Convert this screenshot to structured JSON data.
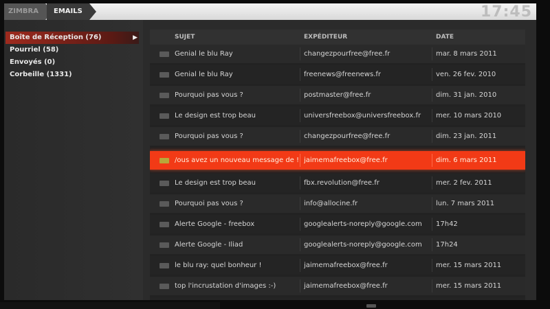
{
  "header": {
    "breadcrumb_app": "ZIMBRA",
    "breadcrumb_section": "EMAILS",
    "clock": "17:45"
  },
  "sidebar": {
    "folders": [
      {
        "label": "Boîte de Réception (76)"
      },
      {
        "label": "Pourriel (58)"
      },
      {
        "label": "Envoyés (0)"
      },
      {
        "label": "Corbeille (1331)"
      }
    ]
  },
  "list": {
    "columns": {
      "subject": "SUJET",
      "sender": "EXPÉDITEUR",
      "date": "DATE"
    },
    "rows": [
      {
        "subject": "Genial le blu Ray",
        "sender": "changezpourfree@free.fr",
        "date": "mar. 8 mars 2011"
      },
      {
        "subject": "Genial le blu Ray",
        "sender": "freenews@freenews.fr",
        "date": "ven. 26 fev. 2010"
      },
      {
        "subject": "Pourquoi pas vous ?",
        "sender": "postmaster@free.fr",
        "date": "dim. 31 jan. 2010"
      },
      {
        "subject": "Le design est trop beau",
        "sender": "universfreebox@universfreebox.fr",
        "date": "mer. 10 mars 2010"
      },
      {
        "subject": "Pourquoi pas vous ?",
        "sender": "changezpourfree@free.fr",
        "date": "dim. 23 jan. 2011"
      },
      {
        "subject": "/ous avez un nouveau message de !",
        "sender": "jaimemafreebox@free.fr",
        "date": "dim. 6 mars 2011"
      },
      {
        "subject": "Le design est trop beau",
        "sender": "fbx.revolution@free.fr",
        "date": "mer. 2 fev. 2011"
      },
      {
        "subject": "Pourquoi pas vous ?",
        "sender": "info@allocine.fr",
        "date": "lun. 7 mars 2011"
      },
      {
        "subject": "Alerte Google - freebox",
        "sender": "googlealerts-noreply@google.com",
        "date": "17h42"
      },
      {
        "subject": "Alerte Google - Iliad",
        "sender": "googlealerts-noreply@google.com",
        "date": "17h24"
      },
      {
        "subject": "le blu ray: quel bonheur !",
        "sender": "jaimemafreebox@free.fr",
        "date": "mer. 15 mars 2011"
      },
      {
        "subject": "top l'incrustation d'images :-)",
        "sender": "jaimemafreebox@free.fr",
        "date": "mer. 15 mars 2011"
      }
    ]
  },
  "colors": {
    "highlight": "#f23a16",
    "selected_folder": "#9e2a1e"
  },
  "icons": {
    "row_icon": "envelope-icon",
    "folder_arrow": "play-arrow-icon"
  }
}
